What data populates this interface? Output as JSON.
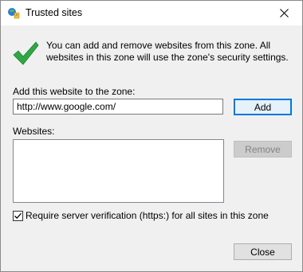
{
  "window": {
    "title": "Trusted sites"
  },
  "info": {
    "message": "You can add and remove websites from this zone. All websites in this zone will use the zone's security settings."
  },
  "add_section": {
    "label": "Add this website to the zone:",
    "url_value": "http://www.google.com/",
    "add_label": "Add"
  },
  "websites_section": {
    "label": "Websites:",
    "items": [],
    "remove_label": "Remove"
  },
  "verification": {
    "label": "Require server verification (https:) for all sites in this zone",
    "checked": true
  },
  "footer": {
    "close_label": "Close"
  },
  "colors": {
    "accent": "#0078d7",
    "check_green": "#2fa844",
    "dialog_bg": "#f0f0f0"
  },
  "icons": [
    "trusted-sites-icon",
    "close-icon",
    "checkmark-icon",
    "checkbox-check-icon"
  ]
}
